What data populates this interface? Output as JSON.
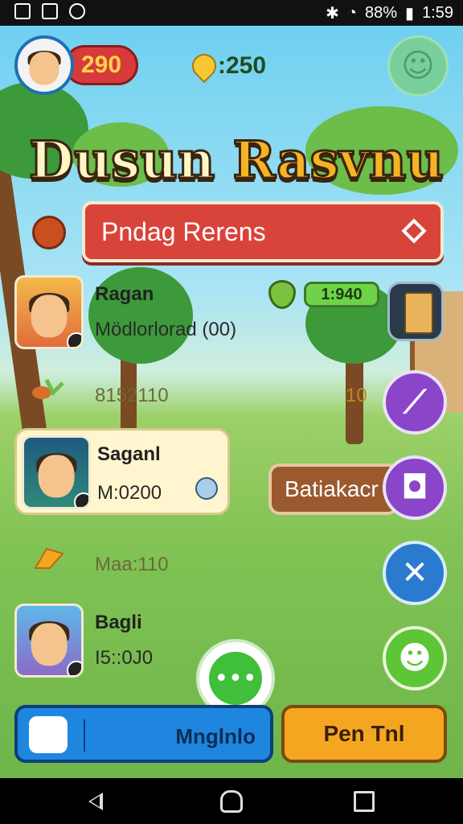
{
  "status_bar": {
    "battery": "88%",
    "time": "1:59"
  },
  "top_bar": {
    "coins": "290",
    "gems": ":250"
  },
  "title": {
    "word1": "Dusun",
    "word2": "Rasvnu"
  },
  "banner": {
    "label": "Pndag Rerens"
  },
  "rows": [
    {
      "name": "Ragan",
      "sub": "Mödlorlorad (00)"
    },
    {
      "name": "Saganl",
      "sub": "M:0200"
    },
    {
      "name": "Bagli",
      "sub": "I5::0J0"
    }
  ],
  "separators": [
    {
      "text": "8152110"
    },
    {
      "text": "Maa:110"
    }
  ],
  "right_panel": {
    "progress": "1:940",
    "small_value": "10",
    "batiakacr": "Batiakacr"
  },
  "bottom": {
    "left_label": "Mnglnlo",
    "right_label": "Pen Tnl"
  },
  "icons": [
    "smiley-icon",
    "gem-icon",
    "shield-icon",
    "diamond-icon",
    "clock-icon",
    "chat-icon",
    "home-icon",
    "back-icon",
    "recents-icon"
  ],
  "colors": {
    "accent": "#d9443a",
    "primary": "#1f86e0",
    "secondary": "#f5a621"
  }
}
